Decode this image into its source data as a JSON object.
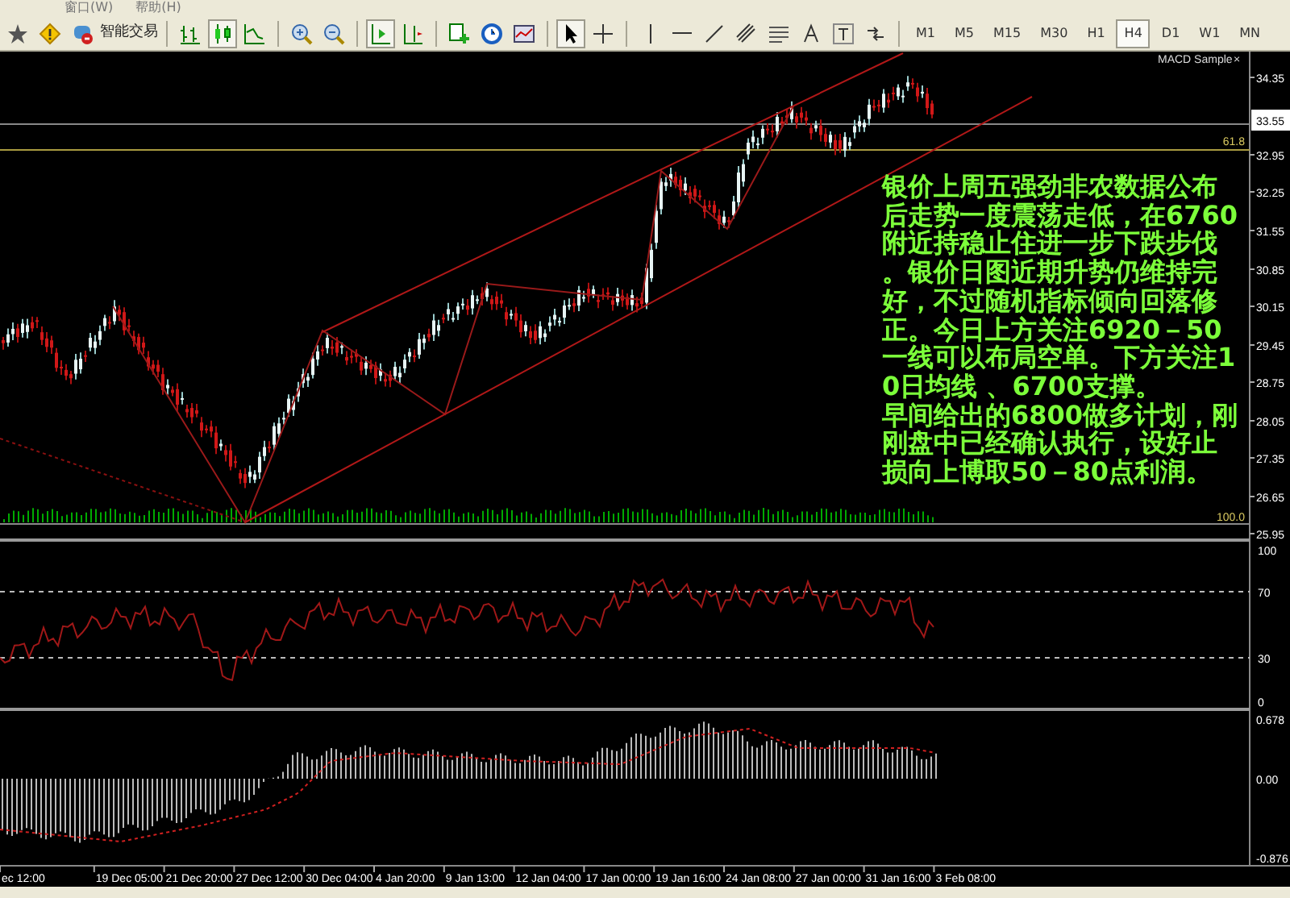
{
  "menu": [
    {
      "label": "窗口(W)"
    },
    {
      "label": "帮助(H)"
    }
  ],
  "toolbar": {
    "expert_label": "智能交易",
    "timeframes": [
      {
        "label": "M1",
        "selected": false
      },
      {
        "label": "M5",
        "selected": false
      },
      {
        "label": "M15",
        "selected": false
      },
      {
        "label": "M30",
        "selected": false
      },
      {
        "label": "H1",
        "selected": false
      },
      {
        "label": "H4",
        "selected": true
      },
      {
        "label": "D1",
        "selected": false
      },
      {
        "label": "W1",
        "selected": false
      },
      {
        "label": "MN",
        "selected": false
      }
    ]
  },
  "chart": {
    "indicator_label": "MACD Sample",
    "close_glyph": "×",
    "price_labels": [
      "34.35",
      "32.95",
      "32.25",
      "31.55",
      "30.85",
      "30.15",
      "29.45",
      "28.75",
      "28.05",
      "27.35",
      "26.65",
      "25.95"
    ],
    "current_price": "33.55",
    "fib_labels": [
      "61.8",
      "100.0"
    ],
    "rsi_labels": [
      "100",
      "70",
      "30",
      "0"
    ],
    "macd_labels": [
      "0.678",
      "0.00",
      "-0.876"
    ],
    "time_labels": [
      "ec 12:00",
      "19 Dec 05:00",
      "21 Dec 20:00",
      "27 Dec 12:00",
      "30 Dec 04:00",
      "4 Jan 20:00",
      "9 Jan 13:00",
      "12 Jan 04:00",
      "17 Jan 00:00",
      "19 Jan 16:00",
      "24 Jan 08:00",
      "27 Jan 00:00",
      "31 Jan 16:00",
      "3 Feb 08:00"
    ],
    "commentary": [
      "银价上周五强劲非农数据公布后走势一度震荡走低，在6760附近持稳止住进一步下跌步伐。银价日图近期升势仍维持完好，不过随机指标倾向回落修正。今日上方关注6920－50一线可以布局空单。下方关注10日均线 、6700支撑。",
      "早间给出的6800做多计划，刚刚盘中已经确认执行，设好止损向上博取50－80点利润。"
    ]
  }
}
